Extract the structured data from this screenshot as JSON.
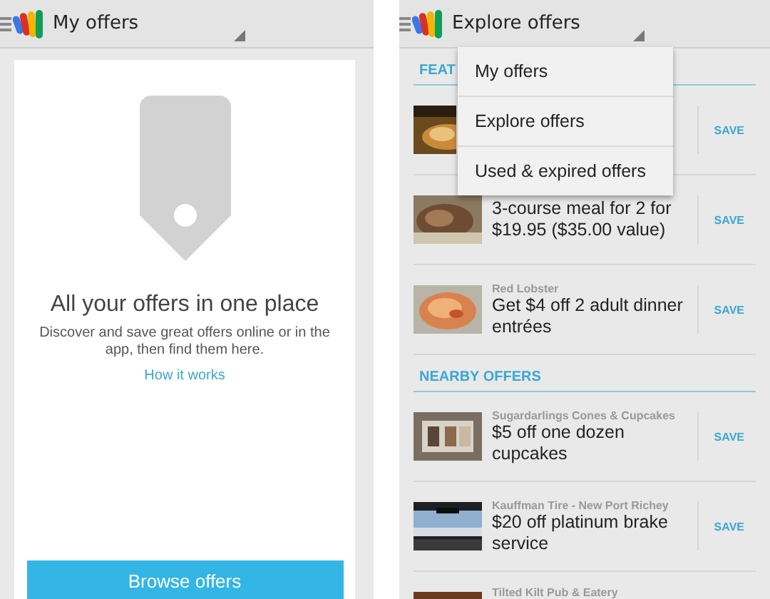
{
  "screens": [
    {
      "kind": "my_offers",
      "title": "My offers",
      "heading": "All your offers in one place",
      "body": "Discover and save great offers online or in the app, then find them here.",
      "link": "How it works",
      "button": "Browse offers"
    },
    {
      "kind": "explore",
      "title": "Explore offers",
      "menu": [
        {
          "label": "My offers"
        },
        {
          "label": "Explore offers"
        },
        {
          "label": "Used & expired offers"
        }
      ],
      "sections": [
        {
          "heading": "FEAT",
          "offers": [
            {
              "action": "SAVE"
            },
            {
              "title": "3-course meal for 2 for $19.95 ($35.00 value)",
              "action": "SAVE"
            },
            {
              "merchant": "Red Lobster",
              "title": "Get $4 off 2 adult dinner entrées",
              "action": "SAVE"
            }
          ]
        },
        {
          "heading": "NEARBY OFFERS",
          "offers": [
            {
              "merchant": "Sugardarlings Cones & Cupcakes",
              "title": "$5 off one dozen cupcakes",
              "action": "SAVE"
            },
            {
              "merchant": "Kauffman Tire - New Port Richey",
              "title": "$20 off platinum brake service",
              "action": "SAVE"
            },
            {
              "merchant": "Tilted Kilt Pub & Eatery"
            }
          ]
        }
      ]
    }
  ]
}
